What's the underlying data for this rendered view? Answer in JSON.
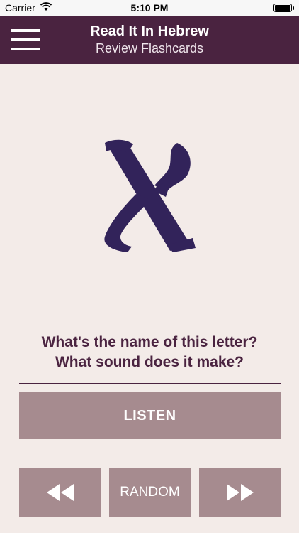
{
  "status_bar": {
    "carrier": "Carrier",
    "time": "5:10 PM"
  },
  "header": {
    "title": "Read It In Hebrew",
    "subtitle": "Review Flashcards"
  },
  "flashcard": {
    "letter": "א",
    "question_line1": "What's the name of this letter?",
    "question_line2": "What sound does it make?"
  },
  "controls": {
    "listen_label": "LISTEN",
    "random_label": "RANDOM",
    "prev_icon": "rewind-icon",
    "next_icon": "fast-forward-icon"
  },
  "colors": {
    "brand": "#4a2340",
    "background": "#f3ebe8",
    "button": "#a68b8f"
  }
}
